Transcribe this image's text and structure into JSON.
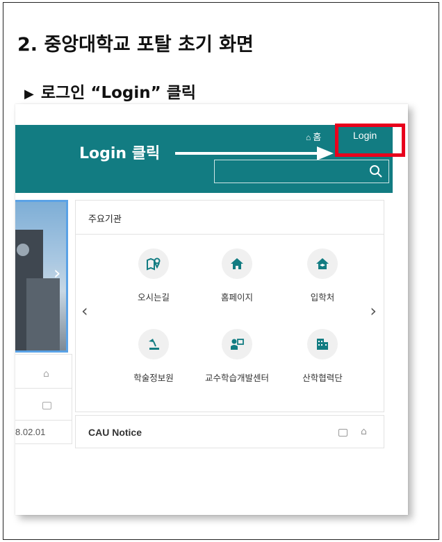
{
  "doc": {
    "heading": "2. 중앙대학교 포탈 초기 화면",
    "subheading_marker": "▶",
    "subheading": "로그인 “Login” 클릭"
  },
  "portal": {
    "header": {
      "home_label": "홈",
      "login_label": "Login",
      "annotation": "Login 클릭",
      "search": {
        "value": "",
        "placeholder": ""
      }
    },
    "organizations": {
      "title": "주요기관",
      "prev": "‹",
      "next": "›",
      "items": [
        {
          "label": "오시는길",
          "icon": "map-pin-icon"
        },
        {
          "label": "홈페이지",
          "icon": "home-icon"
        },
        {
          "label": "입학처",
          "icon": "graduation-cap-icon"
        },
        {
          "label": "학술정보원",
          "icon": "lamp-icon"
        },
        {
          "label": "교수학습개발센터",
          "icon": "teacher-board-icon"
        },
        {
          "label": "산학협력단",
          "icon": "building-icon"
        }
      ]
    },
    "left_panel": {
      "date": "8.02.01"
    },
    "notice": {
      "title": "CAU Notice"
    },
    "colors": {
      "header_bg": "#127c82",
      "highlight": "#e8001c",
      "icon": "#127c82"
    }
  }
}
